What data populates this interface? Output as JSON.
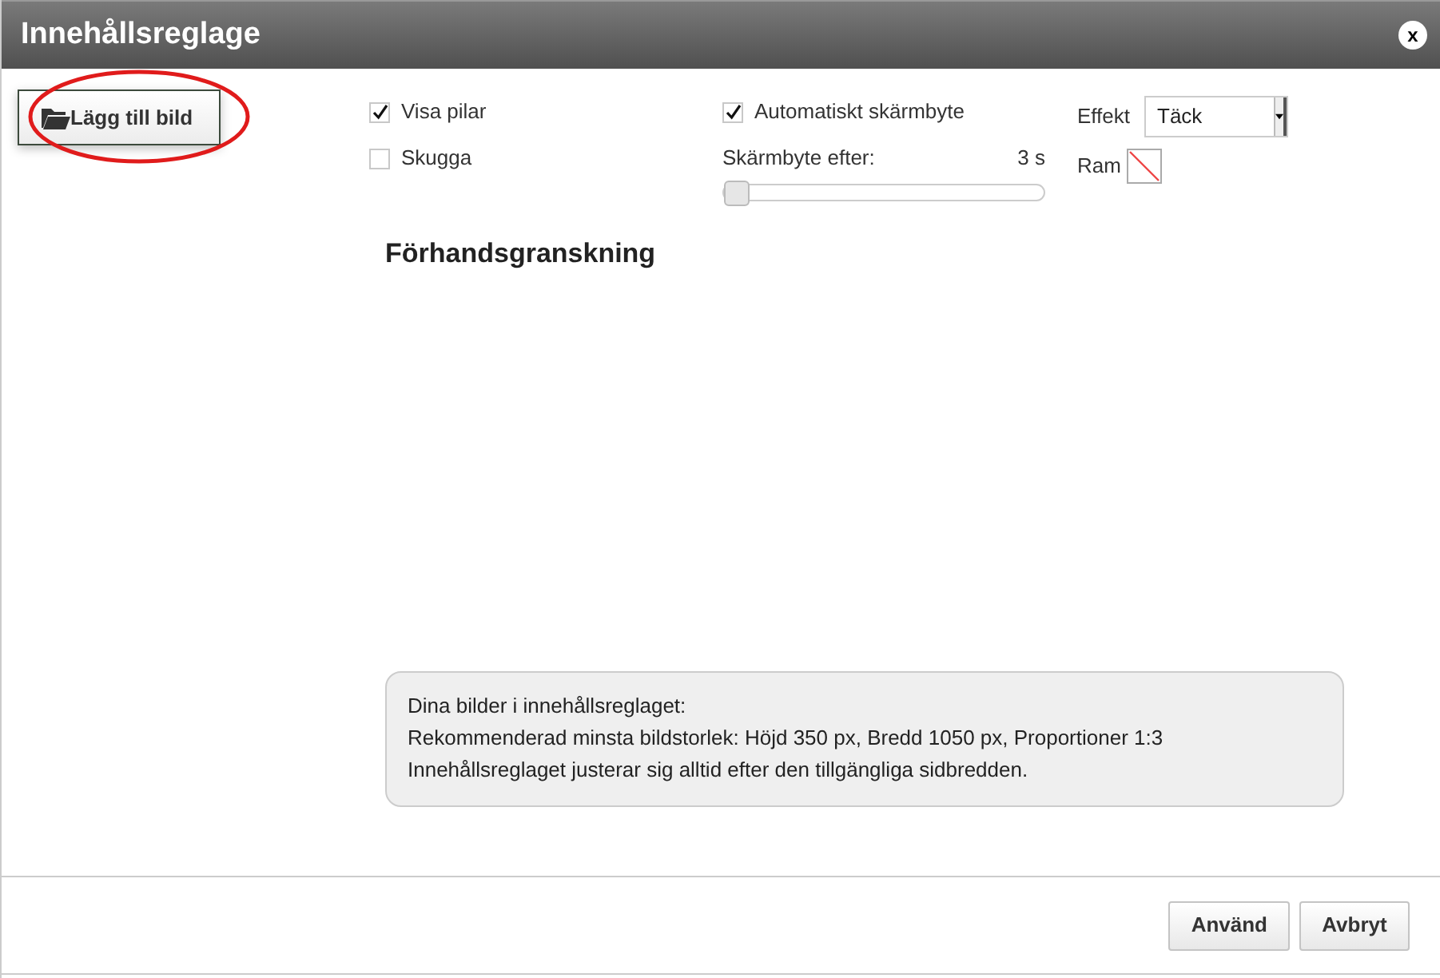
{
  "window": {
    "title": "Innehållsreglage",
    "close": "x"
  },
  "add_image_button": {
    "label": "Lägg till bild",
    "highlighted": true
  },
  "checkboxes": [
    {
      "label": "Visa pilar",
      "checked": true
    },
    {
      "label": "Skugga",
      "checked": false
    }
  ],
  "auto_switch": {
    "label": "Automatiskt skärmbyte",
    "checked": true
  },
  "interval": {
    "label": "Skärmbyte efter:",
    "reading": "3 s",
    "level": 0
  },
  "effect": {
    "label": "Effekt",
    "value": "Täck"
  },
  "frame": {
    "label": "Ram"
  },
  "preview": {
    "heading": "Förhandsgranskning"
  },
  "info": [
    "Dina bilder i innehållsreglaget:",
    "Rekommenderad minsta bildstorlek: Höjd 350 px, Bredd 1050 px, Proportioner 1:3",
    "Innehållsreglaget justerar sig alltid efter den tillgängliga sidbredden."
  ],
  "buttons": [
    "Använd",
    "Avbryt"
  ]
}
